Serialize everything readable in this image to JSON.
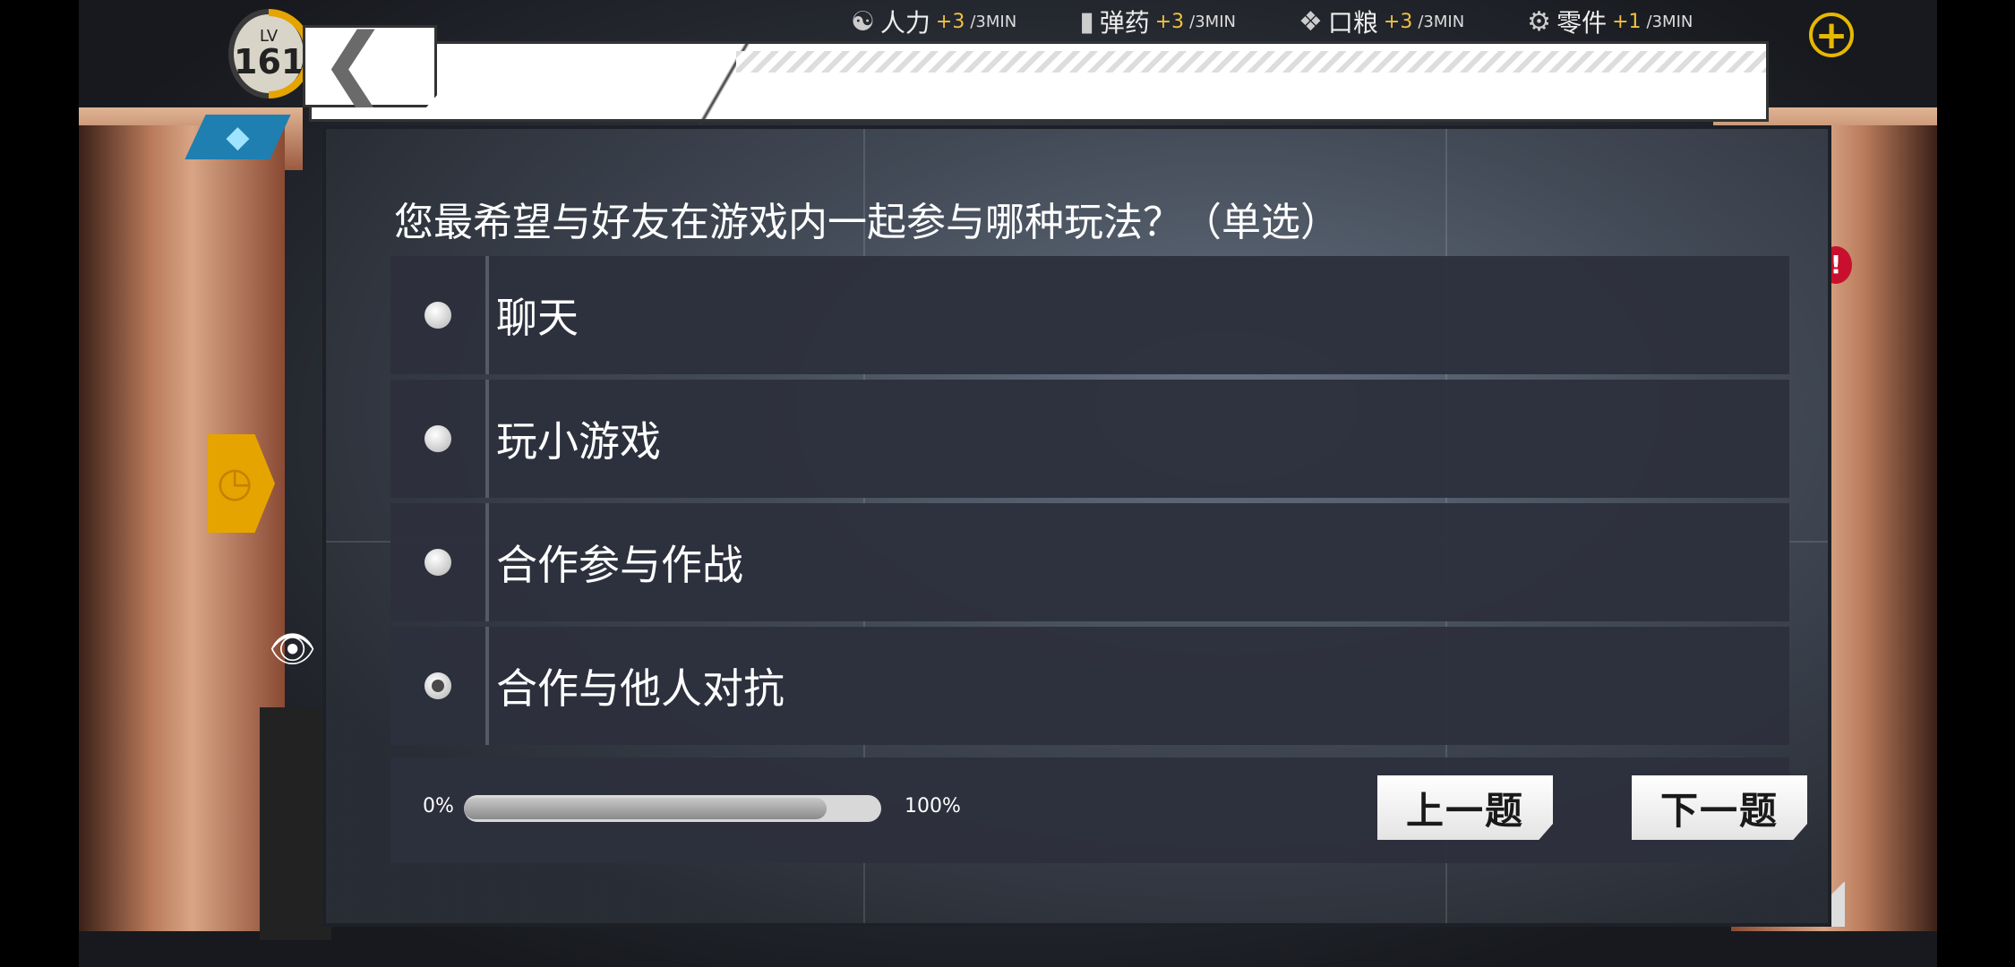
{
  "resources": [
    {
      "name": "人力",
      "rate": "+3",
      "unit": "/3MIN",
      "icon": "people-icon"
    },
    {
      "name": "弹药",
      "rate": "+3",
      "unit": "/3MIN",
      "icon": "ammo-icon"
    },
    {
      "name": "口粮",
      "rate": "+3",
      "unit": "/3MIN",
      "icon": "ration-icon"
    },
    {
      "name": "零件",
      "rate": "+1",
      "unit": "/3MIN",
      "icon": "gear-icon"
    }
  ],
  "player": {
    "level_prefix": "LV",
    "level": "161"
  },
  "survey": {
    "question": "您最希望与好友在游戏内一起参与哪种玩法？（单选）",
    "options": [
      {
        "label": "聊天",
        "selected": false
      },
      {
        "label": "玩小游戏",
        "selected": false
      },
      {
        "label": "合作参与作战",
        "selected": false
      },
      {
        "label": "合作与他人对抗",
        "selected": true
      }
    ],
    "progress": {
      "start_label": "0%",
      "end_label": "100%",
      "fraction": 0.87
    },
    "prev_label": "上一题",
    "next_label": "下一题"
  },
  "notification_badge": "!",
  "colors": {
    "accent": "#e6a400",
    "panel": "#2d303c",
    "gem": "#1e7fb0"
  }
}
